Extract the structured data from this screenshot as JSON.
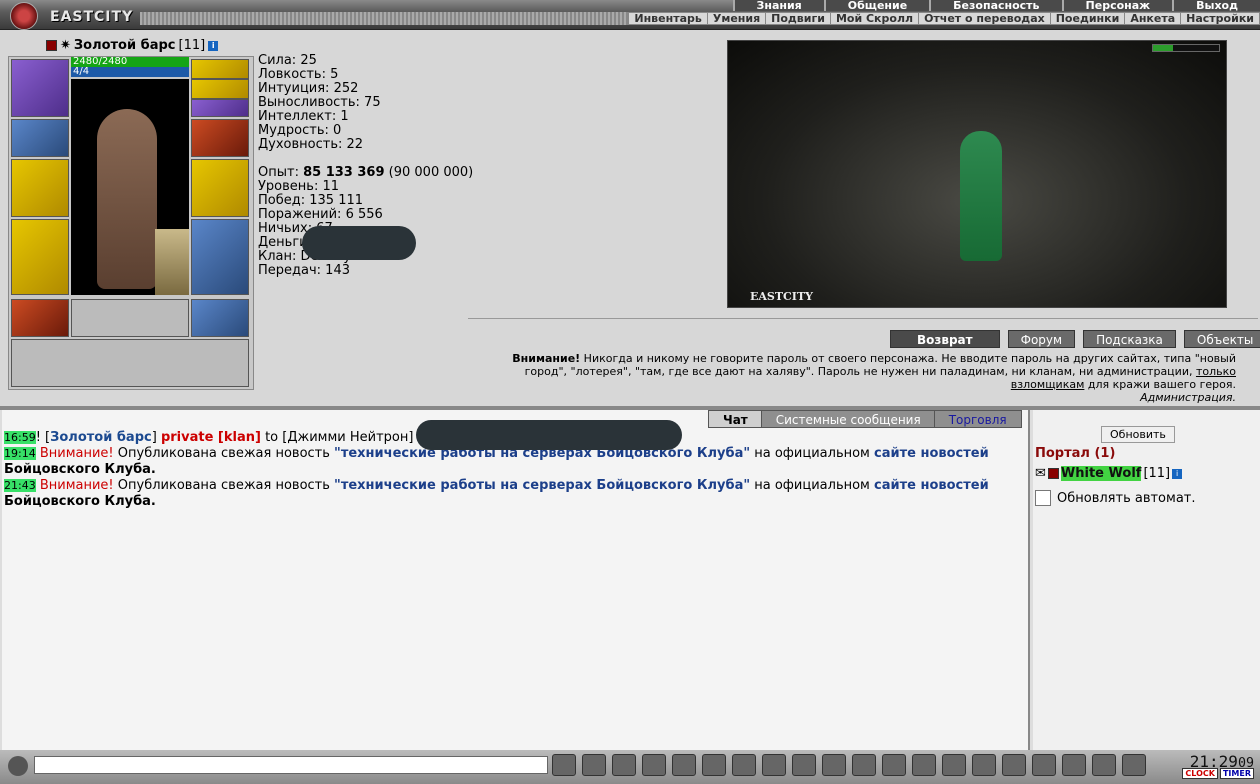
{
  "header": {
    "logo_text": "EASTCITY",
    "menu_top": [
      "Знания",
      "Общение",
      "Безопасность",
      "Персонаж",
      "Выход"
    ],
    "menu_sub": [
      "Инвентарь",
      "Умения",
      "Подвиги",
      "Мой Скролл",
      "Отчет о переводах",
      "Поединки",
      "Анкета",
      "Настройки"
    ]
  },
  "character": {
    "name": "Золотой барс",
    "level": "[11]",
    "hp": "2480/2480",
    "mana": "4/4",
    "stats": [
      "Сила: 25",
      "Ловкость: 5",
      "Интуиция: 252",
      "Выносливость: 75",
      "Интеллект: 1",
      "Мудрость: 0",
      "Духовность: 22"
    ],
    "exp_label": "Опыт:",
    "exp_value": "85 133 369",
    "exp_next": "(90 000 000)",
    "details": [
      "Уровень: 11",
      "Побед: 135 111",
      "Поражений: 6 556",
      "Ничьих: 67",
      "Деньги:",
      "Клан: Destroyers",
      "Передач: 143"
    ]
  },
  "scene": {
    "brand": "EASTCITY"
  },
  "actions": {
    "back": "Возврат",
    "forum": "Форум",
    "hint": "Подсказка",
    "objects": "Объекты"
  },
  "warning": {
    "bold": "Внимание!",
    "text_a": " Никогда и никому не говорите пароль от своего персонажа. Не вводите пароль на других сайтах, типа \"новый город\", \"лотерея\", \"там, где все дают на халяву\". Пароль не нужен ни паладинам, ни кланам, ни администрации, ",
    "link": "только взломщикам",
    "text_b": " для кражи вашего героя.",
    "signature": "Администрация."
  },
  "chat": {
    "tabs": [
      "Чат",
      "Системные сообщения",
      "Торговля"
    ],
    "msg1": {
      "time": "16:59",
      "sender": "Золотой барс",
      "mode": "private [klan]",
      "to": "to [Джимми Нейтрон]"
    },
    "msg2": {
      "time": "19:14",
      "warn": "Внимание!",
      "text": " Опубликована свежая новость ",
      "news": "\"технические работы на серверах Бойцовского Клуба\"",
      "after": " на официальном ",
      "link": "сайте новостей",
      "tail": "Бойцовского Клуба."
    },
    "msg3": {
      "time": "21:43",
      "warn": "Внимание!",
      "text": " Опубликована свежая новость ",
      "news": "\"технические работы на серверах Бойцовского Клуба\"",
      "after": " на официальном ",
      "link": "сайте новостей",
      "tail": "Бойцовского Клуба."
    }
  },
  "side": {
    "refresh": "Обновить",
    "location": "Портал (1)",
    "player": "White Wolf",
    "player_level": "[11]",
    "auto_label": "Обновлять автомат."
  },
  "clock": {
    "time": "21:29",
    "seconds": "09",
    "label1": "CLOCK",
    "label2": "TIMER"
  }
}
